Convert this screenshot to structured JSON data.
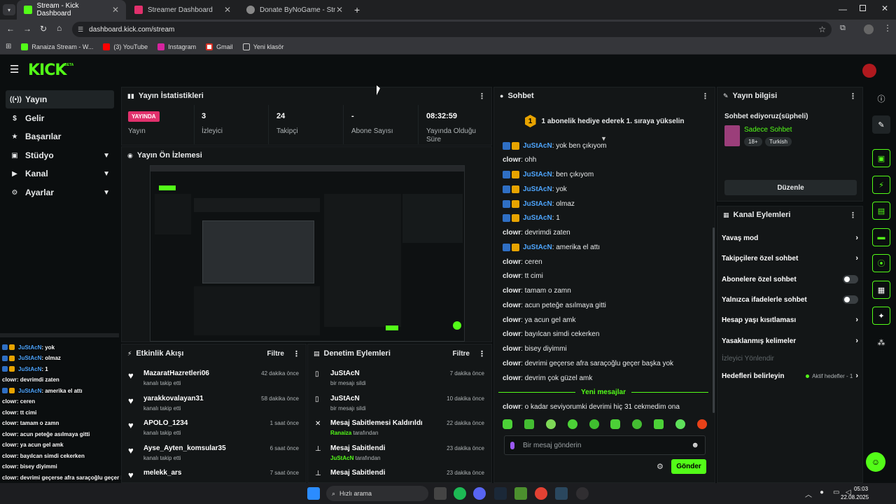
{
  "browser": {
    "tabs": [
      {
        "title": "Stream - Kick Dashboard",
        "active": true
      },
      {
        "title": "Streamer Dashboard",
        "active": false
      },
      {
        "title": "Donate ByNoGame - Streamer",
        "active": false
      }
    ],
    "url": "dashboard.kick.com/stream",
    "bookmarks": [
      "Ranaiza Stream - W...",
      "(3) YouTube",
      "Instagram",
      "Gmail",
      "Yeni klasör"
    ]
  },
  "header": {
    "logo": "KICK",
    "beta": "BETA"
  },
  "sidebar": {
    "items": [
      {
        "label": "Yayın",
        "active": true,
        "chevron": false
      },
      {
        "label": "Gelir",
        "chevron": false
      },
      {
        "label": "Başarılar",
        "chevron": false
      },
      {
        "label": "Stüdyo",
        "chevron": true
      },
      {
        "label": "Kanal",
        "chevron": true
      },
      {
        "label": "Ayarlar",
        "chevron": true
      }
    ]
  },
  "stats": {
    "title": "Yayın İstatistikleri",
    "live_badge": "YAYINDA",
    "items": [
      {
        "value": "",
        "label": "Yayın"
      },
      {
        "value": "3",
        "label": "İzleyici"
      },
      {
        "value": "24",
        "label": "Takipçi"
      },
      {
        "value": "-",
        "label": "Abone Sayısı"
      },
      {
        "value": "08:32:59",
        "label": "Yayında Olduğu Süre"
      }
    ]
  },
  "preview": {
    "title": "Yayın Ön İzlemesi"
  },
  "activity": {
    "title": "Etkinlik Akışı",
    "filter": "Filtre",
    "items": [
      {
        "user": "MazaratHazretleri06",
        "sub": "kanalı takip etti",
        "time": "42 dakika önce"
      },
      {
        "user": "yarakkovalayan31",
        "sub": "kanalı takip etti",
        "time": "58 dakika önce"
      },
      {
        "user": "APOLO_1234",
        "sub": "kanalı takip etti",
        "time": "1 saat önce"
      },
      {
        "user": "Ayse_Ayten_komsular35",
        "sub": "kanalı takip etti",
        "time": "6 saat önce"
      },
      {
        "user": "melekk_ars",
        "sub": "",
        "time": "7 saat önce"
      }
    ]
  },
  "moderation": {
    "title": "Denetim Eylemleri",
    "filter": "Filtre",
    "items": [
      {
        "title": "JuStAcN",
        "sub": "bir mesajı sildi",
        "sub_user": "",
        "time": "7 dakika önce"
      },
      {
        "title": "JuStAcN",
        "sub": "bir mesajı sildi",
        "sub_user": "",
        "time": "10 dakika önce"
      },
      {
        "title": "Mesaj Sabitlemesi Kaldırıldı",
        "sub": "tarafından",
        "sub_user": "Ranaiza",
        "time": "22 dakika önce"
      },
      {
        "title": "Mesaj Sabitlendi",
        "sub": "tarafından",
        "sub_user": "JuStAcN",
        "time": "23 dakika önce"
      },
      {
        "title": "Mesaj Sabitlendi",
        "sub": "",
        "sub_user": "",
        "time": "23 dakika önce"
      }
    ]
  },
  "chat": {
    "title": "Sohbet",
    "goal_number": "1",
    "goal_text": "1 abonelik hediye ederek 1. sıraya yükselin",
    "messages": [
      {
        "user": "JuStAcN",
        "text": ": yok ben çıkıyom",
        "badged": true
      },
      {
        "user": "clowr",
        "text": ": ohh",
        "badged": false
      },
      {
        "user": "JuStAcN",
        "text": ": ben çıkıyom",
        "badged": true
      },
      {
        "user": "JuStAcN",
        "text": ": yok",
        "badged": true
      },
      {
        "user": "JuStAcN",
        "text": ": olmaz",
        "badged": true
      },
      {
        "user": "JuStAcN",
        "text": ": 1",
        "badged": true
      },
      {
        "user": "clowr",
        "text": ": devrimdi zaten",
        "badged": false
      },
      {
        "user": "JuStAcN",
        "text": ": amerika el attı",
        "badged": true
      },
      {
        "user": "clowr",
        "text": ": ceren",
        "badged": false
      },
      {
        "user": "clowr",
        "text": ": tt cimi",
        "badged": false
      },
      {
        "user": "clowr",
        "text": ": tamam o zamn",
        "badged": false
      },
      {
        "user": "clowr",
        "text": ": acun peteğe asılmaya gitti",
        "badged": false
      },
      {
        "user": "clowr",
        "text": ": ya acun gel amk",
        "badged": false
      },
      {
        "user": "clowr",
        "text": ": bayılcan simdi cekerken",
        "badged": false
      },
      {
        "user": "clowr",
        "text": ": bisey diyimmi",
        "badged": false
      },
      {
        "user": "clowr",
        "text": ": devrimi geçerse afra saraçoğlu geçer başka yok",
        "badged": false
      },
      {
        "user": "clowr",
        "text": ": devrim çok güzel amk",
        "badged": false
      }
    ],
    "new_messages": "Yeni mesajlar",
    "last_message": {
      "user": "clowr",
      "text": ": o kadar seviyorumki devrimi hiç 31 cekmedim ona"
    },
    "input_placeholder": "Bir mesaj gönderin",
    "send": "Gönder"
  },
  "stream_info": {
    "title": "Yayın bilgisi",
    "stream_title": "Sohbet ediyoruz(süpheli)",
    "category": "Sadece Sohbet",
    "tags": [
      "18+",
      "Turkish"
    ],
    "edit": "Düzenle"
  },
  "channel_actions": {
    "title": "Kanal Eylemleri",
    "items": [
      {
        "label": "Yavaş mod",
        "type": "arrow"
      },
      {
        "label": "Takipçilere özel sohbet",
        "type": "arrow"
      },
      {
        "label": "Abonelere özel sohbet",
        "type": "toggle"
      },
      {
        "label": "Yalnızca ifadelerle sohbet",
        "type": "toggle"
      },
      {
        "label": "Hesap yaşı kısıtlaması",
        "type": "arrow"
      },
      {
        "label": "Yasaklanmış kelimeler",
        "type": "arrow"
      }
    ],
    "viewer_redirect": "İzleyici Yönlendir",
    "goals_label": "Hedefleri belirleyin",
    "goals_status": "Aktif hedefler - 1"
  },
  "overlay_chat": [
    {
      "user": "JuStAcN",
      "text": " : yok",
      "badged": true
    },
    {
      "user": "JuStAcN",
      "text": " : olmaz",
      "badged": true
    },
    {
      "user": "JuStAcN",
      "text": " : 1",
      "badged": true
    },
    {
      "user": "clowr",
      "text": " : devrimdi zaten",
      "badged": false
    },
    {
      "user": "JuStAcN",
      "text": " : amerika el attı",
      "badged": true
    },
    {
      "user": "clowr",
      "text": " : ceren",
      "badged": false
    },
    {
      "user": "clowr",
      "text": " : tt cimi",
      "badged": false
    },
    {
      "user": "clowr",
      "text": " : tamam o zamn",
      "badged": false
    },
    {
      "user": "clowr",
      "text": " : acun peteğe asılmaya gitti",
      "badged": false
    },
    {
      "user": "clowr",
      "text": " : ya acun gel amk",
      "badged": false
    },
    {
      "user": "clowr",
      "text": " : bayılcan simdi cekerken",
      "badged": false
    },
    {
      "user": "clowr",
      "text": " : bisey diyimmi",
      "badged": false
    },
    {
      "user": "clowr",
      "text": " : devrimi geçerse afra saraçoğlu geçer başka yok",
      "badged": false
    },
    {
      "user": "clowr",
      "text": " : devrim çok güzel amk",
      "badged": false
    },
    {
      "user": "clowr",
      "text": " : o kadar seviyorumki devrimi hiç 31 cekmedim ona",
      "badged": false
    }
  ],
  "taskbar": {
    "search": "Hızlı arama",
    "time": "05:03",
    "date": "22.08.2025"
  },
  "colors": {
    "accent": "#53fc18",
    "live": "#e1306c",
    "mention": "#4ea6ff"
  }
}
